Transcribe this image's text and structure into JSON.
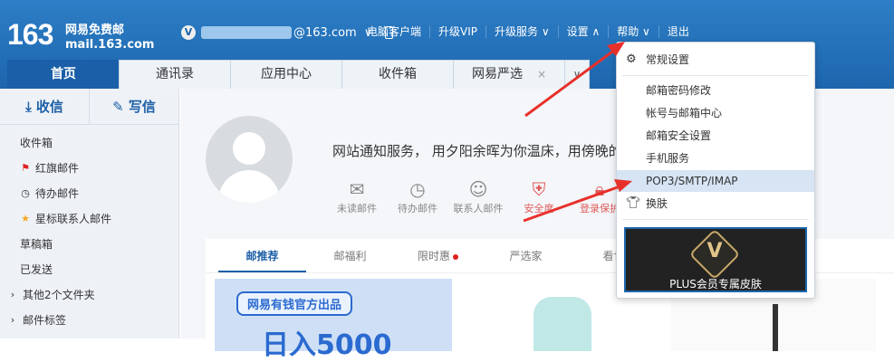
{
  "header": {
    "logo_num": "163",
    "logo_line1": "网易免费邮",
    "logo_line2": "mail.163.com",
    "vip_badge": "V",
    "email_suffix": "@163.com",
    "account_caret": "∨",
    "nav": [
      "电脑客户端",
      "升级VIP",
      "升级服务 ∨",
      "设置 ∧",
      "帮助 ∨",
      "退出"
    ]
  },
  "tabs": [
    {
      "label": "首页"
    },
    {
      "label": "通讯录"
    },
    {
      "label": "应用中心"
    },
    {
      "label": "收件箱"
    },
    {
      "label": "网易严选",
      "close": "×"
    }
  ],
  "tab_more": "∨",
  "sidebar": {
    "receive": "收信",
    "compose": "写信",
    "items": [
      {
        "label": "收件箱",
        "icon": ""
      },
      {
        "label": "红旗邮件",
        "icon": "flag-icon"
      },
      {
        "label": "待办邮件",
        "icon": "clock-icon"
      },
      {
        "label": "星标联系人邮件",
        "icon": "star-icon"
      },
      {
        "label": "草稿箱",
        "icon": ""
      },
      {
        "label": "已发送",
        "icon": ""
      },
      {
        "label": "其他2个文件夹",
        "icon": "caret-right-icon"
      },
      {
        "label": "邮件标签",
        "icon": "caret-right-icon"
      }
    ]
  },
  "main": {
    "notice": "网站通知服务， 用夕阳余晖为你温床，用傍晚的",
    "quick": [
      {
        "label": "未读邮件",
        "icon": "envelope-icon"
      },
      {
        "label": "待办邮件",
        "icon": "clock-icon"
      },
      {
        "label": "联系人邮件",
        "icon": "contact-star-icon"
      },
      {
        "label": "安全度",
        "icon": "shield-icon"
      },
      {
        "label": "登录保护",
        "icon": "lock-icon"
      }
    ],
    "card_tabs": [
      "邮推荐",
      "邮福利",
      "限时惠",
      "严选家",
      "看世"
    ],
    "promo_tag": "网易有钱官方出品",
    "promo_big": "日入5000"
  },
  "dropdown": {
    "items": [
      {
        "label": "常规设置",
        "icon": "gear-icon"
      },
      {
        "label": "邮箱密码修改"
      },
      {
        "label": "帐号与邮箱中心"
      },
      {
        "label": "邮箱安全设置"
      },
      {
        "label": "手机服务"
      },
      {
        "label": "POP3/SMTP/IMAP",
        "highlighted": true
      },
      {
        "label": "换肤",
        "icon": "tshirt-icon"
      }
    ],
    "banner_letter": "V",
    "banner_text": "PLUS会员专属皮肤"
  }
}
